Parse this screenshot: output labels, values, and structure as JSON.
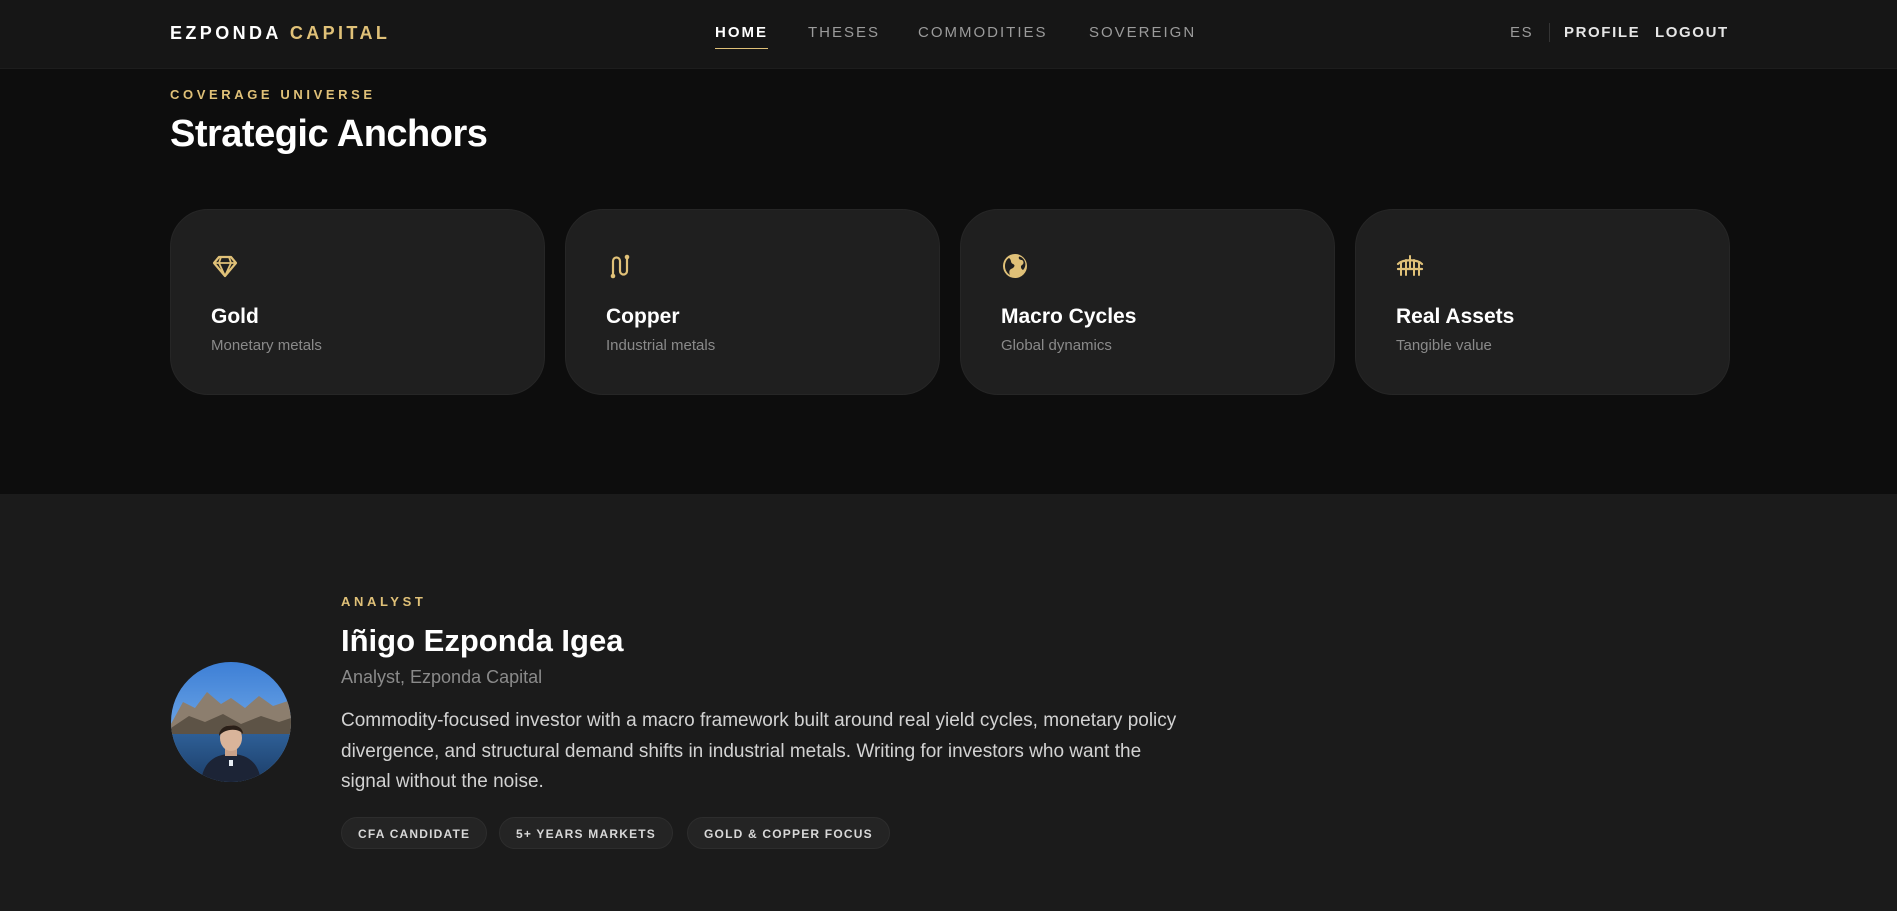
{
  "brand": {
    "part1": "EZPONDA",
    "part2": "CAPITAL"
  },
  "nav": {
    "links": [
      {
        "label": "HOME",
        "active": true
      },
      {
        "label": "THESES",
        "active": false
      },
      {
        "label": "COMMODITIES",
        "active": false
      },
      {
        "label": "SOVEREIGN",
        "active": false
      }
    ],
    "lang": "ES",
    "profile": "PROFILE",
    "logout": "LOGOUT"
  },
  "coverage": {
    "eyebrow": "COVERAGE UNIVERSE",
    "title": "Strategic Anchors",
    "cards": [
      {
        "icon": "diamond-icon",
        "title": "Gold",
        "subtitle": "Monetary metals"
      },
      {
        "icon": "route-icon",
        "title": "Copper",
        "subtitle": "Industrial metals"
      },
      {
        "icon": "globe-icon",
        "title": "Macro Cycles",
        "subtitle": "Global dynamics"
      },
      {
        "icon": "bridge-icon",
        "title": "Real Assets",
        "subtitle": "Tangible value"
      }
    ]
  },
  "analyst": {
    "eyebrow": "ANALYST",
    "name": "Iñigo Ezponda Igea",
    "role": "Analyst, Ezponda Capital",
    "bio": "Commodity-focused investor with a macro framework built around real yield cycles, monetary policy divergence, and structural demand shifts in industrial metals. Writing for investors who want the signal without the noise.",
    "badges": [
      "CFA CANDIDATE",
      "5+ YEARS MARKETS",
      "GOLD & COPPER FOCUS"
    ]
  },
  "colors": {
    "accent": "#e0c178",
    "background": "#0d0d0d",
    "card": "#1f1f1f",
    "section": "#1b1b1b"
  }
}
